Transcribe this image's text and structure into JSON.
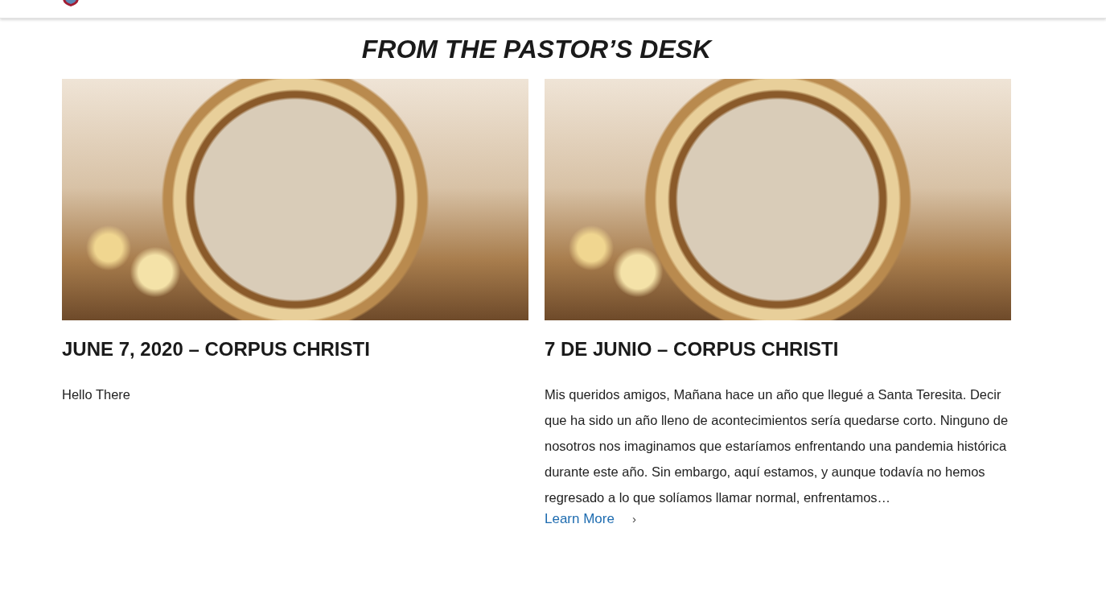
{
  "section": {
    "title": "FROM THE PASTOR’S DESK"
  },
  "posts": [
    {
      "title": "JUNE 7, 2020 – CORPUS CHRISTI",
      "excerpt": "Hello There"
    },
    {
      "title": "7 DE JUNIO – CORPUS CHRISTI",
      "excerpt": "Mis queridos amigos, Mañana hace un año que llegué a Santa Teresita. Decir que ha sido un año lleno de acontecimientos sería quedarse corto. Ninguno de nosotros nos imaginamos que estaríamos enfrentando una pandemia histórica durante este año. Sin embargo, aquí estamos, y aunque todavía no hemos regresado a lo que solíamos llamar normal, enfrentamos…",
      "link": {
        "label": "Learn More",
        "chevron": "›"
      }
    }
  ]
}
